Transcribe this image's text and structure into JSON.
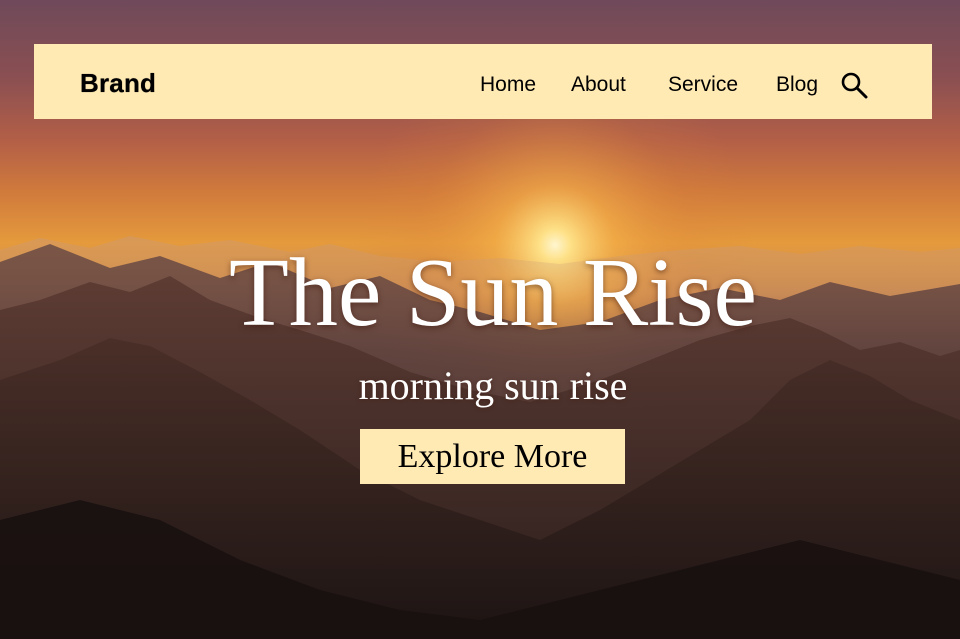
{
  "navbar": {
    "brand": "Brand",
    "links": [
      {
        "label": "Home"
      },
      {
        "label": "About"
      },
      {
        "label": "Service"
      },
      {
        "label": "Blog"
      }
    ],
    "search_icon": "search-icon",
    "background_color": "#ffeab4"
  },
  "hero": {
    "title": "The Sun Rise",
    "subtitle": "morning sun rise",
    "cta_label": "Explore More",
    "cta_color": "#ffeab4",
    "background": "sunrise over mountain range"
  }
}
